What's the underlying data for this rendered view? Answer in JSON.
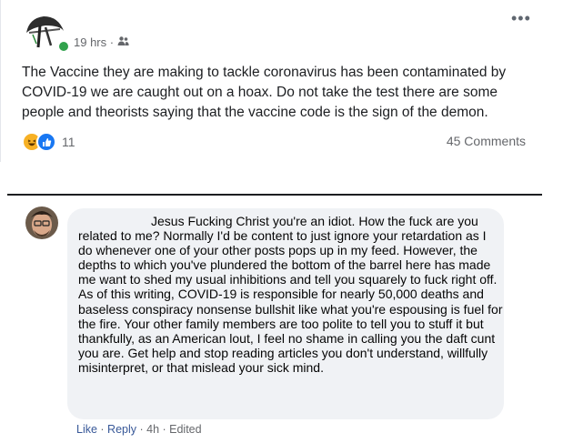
{
  "post": {
    "time": "19 hrs ·",
    "audience_icon": "friends-icon",
    "more_label": "•••",
    "text": "The Vaccine they are making to tackle coronavirus has been contaminated by COVID-19 we are caught out on a hoax. Do not take the test there are some people and theorists saying that the vaccine code is the sign of the demon.",
    "reactions": {
      "icons": [
        "haha-icon",
        "like-icon"
      ],
      "count": "11"
    },
    "comments_label": "45 Comments"
  },
  "comment": {
    "text": "Jesus Fucking Christ you're an idiot. How the fuck are you related to me? Normally I'd be content to just ignore your retardation as I do whenever one of your other posts pops up in my feed. However, the depths to which you've plundered the bottom of the barrel here has made me want to shed my usual inhibitions and tell you squarely to fuck right off. As of this writing, COVID-19 is responsible for nearly 50,000 deaths and baseless conspiracy nonsense bullshit like what you're espousing is fuel for the fire. Your other family members are too polite to tell you to stuff it but thankfully, as an American lout, I feel no shame in calling you the daft cunt you are. Get help and stop reading articles you don't understand, willfully misinterpret, or that mislead your sick mind.",
    "actions": {
      "like": "Like",
      "sep1": " · ",
      "reply": "Reply",
      "sep2": " · ",
      "time": "4h",
      "sep3": " · ",
      "edited": "Edited"
    }
  }
}
